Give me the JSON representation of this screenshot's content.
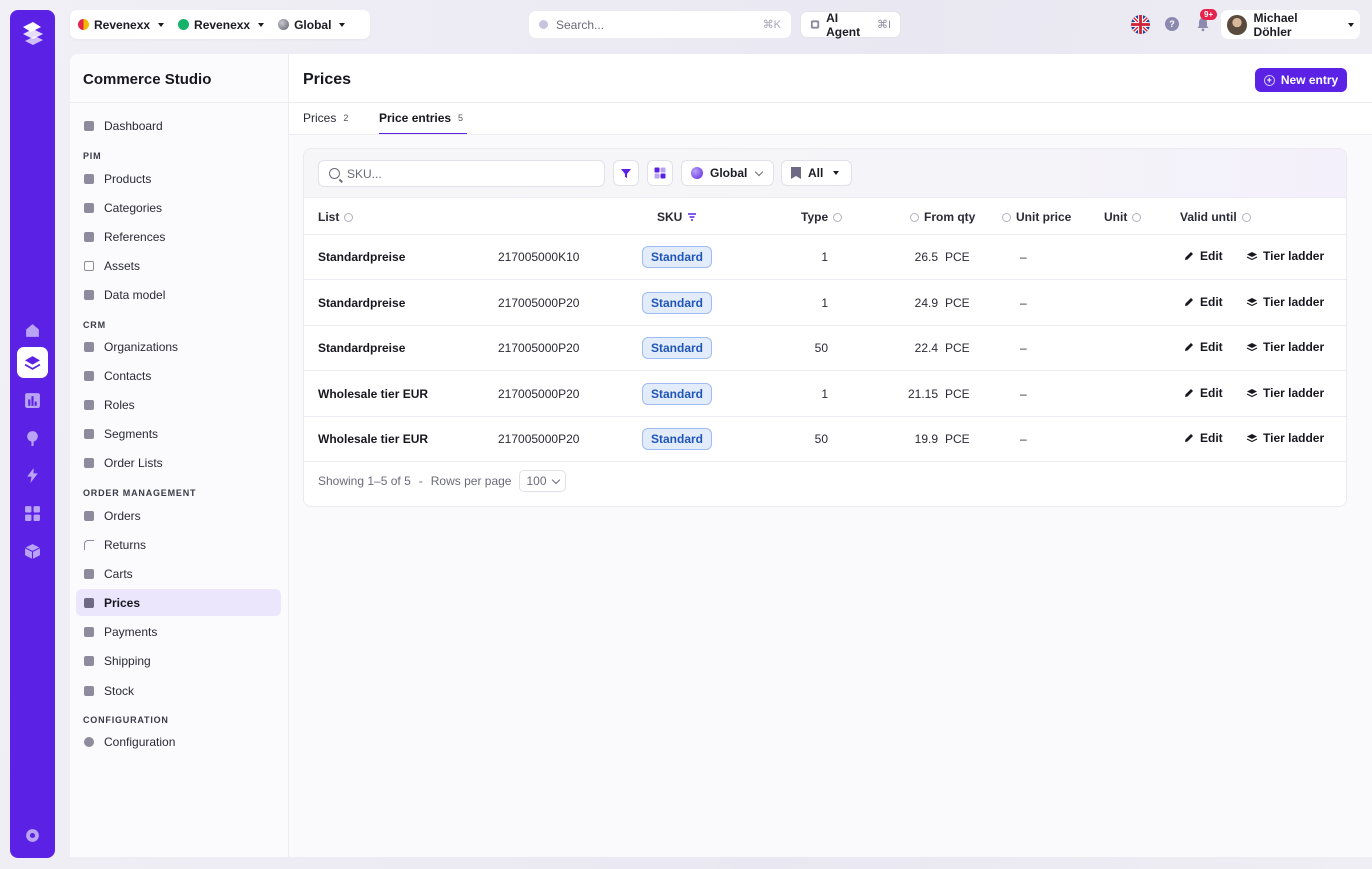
{
  "colors": {
    "brand": "#5b22e6",
    "pill_bg": "#e3ecfb",
    "pill_text": "#2055b8",
    "badge": "#e5234b"
  },
  "topbar": {
    "tenant1": "Revenexx",
    "tenant2": "Revenexx",
    "scope": "Global",
    "search_placeholder": "Search...",
    "search_shortcut": "⌘K",
    "ai_agent": "AI Agent",
    "ai_shortcut": "⌘I",
    "notifications_badge": "9+",
    "help": "?",
    "user_name": "Michael Döhler"
  },
  "sidebar": {
    "title": "Commerce Studio",
    "dashboard": "Dashboard",
    "sections": {
      "pim": "PIM",
      "crm": "CRM",
      "order_management": "ORDER MANAGEMENT",
      "configuration": "CONFIGURATION"
    },
    "pim_items": [
      "Products",
      "Categories",
      "References",
      "Assets",
      "Data model"
    ],
    "crm_items": [
      "Organizations",
      "Contacts",
      "Roles",
      "Segments",
      "Order Lists"
    ],
    "om_items": [
      "Orders",
      "Returns",
      "Carts",
      "Prices",
      "Payments",
      "Shipping",
      "Stock"
    ],
    "config_items": [
      "Configuration"
    ],
    "active": "Prices"
  },
  "main": {
    "title": "Prices",
    "new_entry": "New entry",
    "tabs": [
      {
        "label": "Prices",
        "count": "2"
      },
      {
        "label": "Price entries",
        "count": "5"
      }
    ],
    "toolbar": {
      "search_placeholder": "SKU...",
      "scope": "Global",
      "list_filter": "All"
    },
    "columns": {
      "list": "List",
      "sku": "SKU",
      "type": "Type",
      "from_qty": "From qty",
      "unit_price": "Unit price",
      "unit": "Unit",
      "valid_until": "Valid until"
    },
    "rows": [
      {
        "list": "Standardpreise",
        "sku": "217005000K10",
        "type": "Standard",
        "from_qty": "1",
        "unit_price": "26.5",
        "unit": "PCE",
        "valid_until": "–"
      },
      {
        "list": "Standardpreise",
        "sku": "217005000P20",
        "type": "Standard",
        "from_qty": "1",
        "unit_price": "24.9",
        "unit": "PCE",
        "valid_until": "–"
      },
      {
        "list": "Standardpreise",
        "sku": "217005000P20",
        "type": "Standard",
        "from_qty": "50",
        "unit_price": "22.4",
        "unit": "PCE",
        "valid_until": "–"
      },
      {
        "list": "Wholesale tier EUR",
        "sku": "217005000P20",
        "type": "Standard",
        "from_qty": "1",
        "unit_price": "21.15",
        "unit": "PCE",
        "valid_until": "–"
      },
      {
        "list": "Wholesale tier EUR",
        "sku": "217005000P20",
        "type": "Standard",
        "from_qty": "50",
        "unit_price": "19.9",
        "unit": "PCE",
        "valid_until": "–"
      }
    ],
    "row_actions": {
      "edit": "Edit",
      "tier_ladder": "Tier ladder"
    },
    "footer": {
      "showing": "Showing 1–5 of 5",
      "separator": "-",
      "rows_per_page_label": "Rows per page",
      "rows_per_page": "100"
    }
  }
}
